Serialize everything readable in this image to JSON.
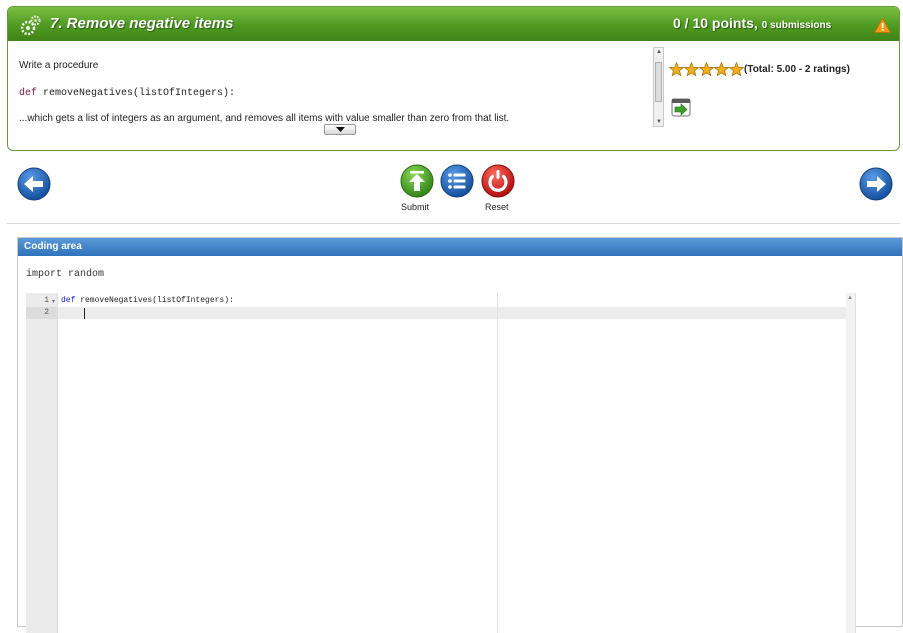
{
  "exercise": {
    "title": "7. Remove negative items",
    "points": "0 / 10 points,",
    "submissions": "0 submissions",
    "description_intro": "Write a procedure",
    "code_keyword": "def",
    "code_signature": " removeNegatives(listOfIntegers):",
    "description_body": "...which gets a list of integers as an argument, and removes all items with value smaller than zero from that list.",
    "rating_text": "(Total: 5.00 - 2 ratings)",
    "star_count": 5,
    "rating_value": 5.0
  },
  "toolbar": {
    "submit_label": "Submit",
    "reset_label": "Reset"
  },
  "coding_area": {
    "header": "Coding area",
    "import_line": "import random",
    "lines": [
      {
        "number": "1",
        "keyword": "def",
        "text": " removeNegatives(listOfIntegers):"
      },
      {
        "number": "2",
        "keyword": "",
        "text": ""
      }
    ]
  },
  "icons": {
    "title": "gear-icon",
    "warning": "warning-icon",
    "run": "run-program-icon",
    "prev": "arrow-left-icon",
    "next": "arrow-right-icon",
    "submit": "upload-icon",
    "list": "list-icon",
    "reset": "reset-icon"
  },
  "colors": {
    "header_green": "#4f9a22",
    "coding_header_blue": "#2f72bb",
    "nav_blue": "#1f5fb0",
    "submit_green": "#4aa022",
    "reset_red": "#d42020",
    "star_gold": "#f0b020"
  }
}
